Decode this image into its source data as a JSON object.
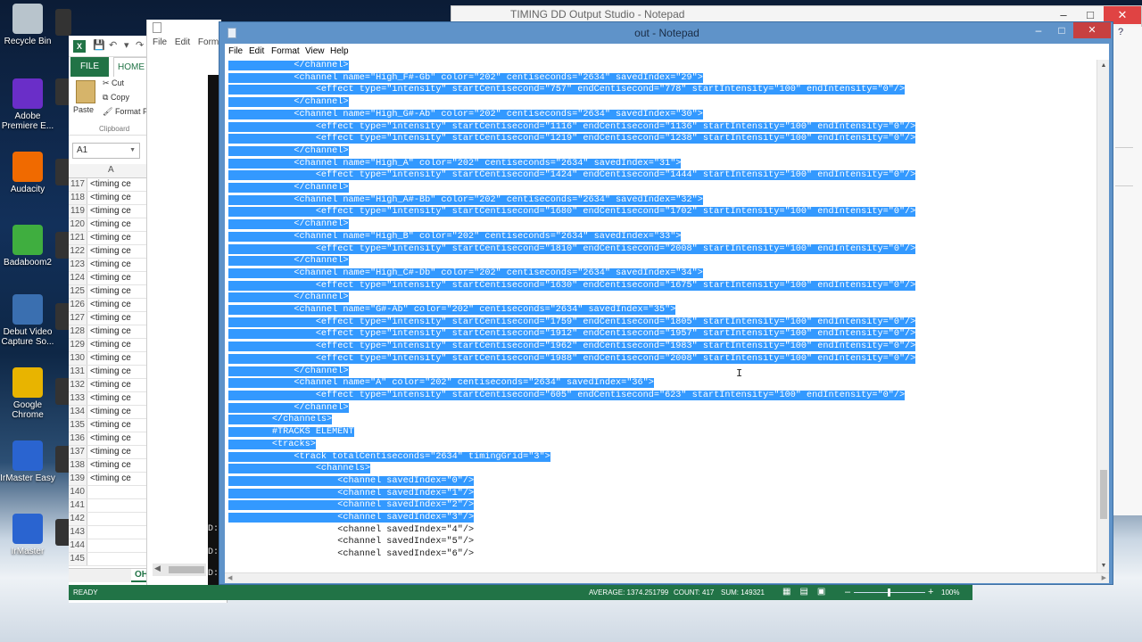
{
  "desktop": {
    "icons": [
      {
        "label": "Recycle Bin",
        "icon": "recycle-bin-icon",
        "color": "#b8c4cc"
      },
      {
        "label": "Adobe Premiere E...",
        "icon": "premiere-icon",
        "color": "#6a2ec8"
      },
      {
        "label": "Audacity",
        "icon": "audacity-icon",
        "color": "#f06a00"
      },
      {
        "label": "Badaboom2",
        "icon": "badaboom-icon",
        "color": "#3fae3f"
      },
      {
        "label": "Debut Video Capture So...",
        "icon": "debut-icon",
        "color": "#3a6fb0"
      },
      {
        "label": "Google Chrome",
        "icon": "chrome-icon",
        "color": "#e8b400"
      },
      {
        "label": "IrMaster Easy",
        "icon": "irmaster-easy-icon",
        "color": "#2a64d0"
      },
      {
        "label": "IrMaster",
        "icon": "irmaster-icon",
        "color": "#2a64d0"
      }
    ]
  },
  "background_window": {
    "title": "TIMING DD Output Studio - Notepad"
  },
  "excel": {
    "file_tab": "FILE",
    "home_tab": "HOME",
    "paste": "Paste",
    "cut": "Cut",
    "copy": "Copy",
    "format_painter": "Format P",
    "clipboard": "Clipboard",
    "name_box": "A1",
    "col_header": "A",
    "rows": [
      {
        "n": "117",
        "v": "<timing ce"
      },
      {
        "n": "118",
        "v": "<timing ce"
      },
      {
        "n": "119",
        "v": "<timing ce"
      },
      {
        "n": "120",
        "v": "<timing ce"
      },
      {
        "n": "121",
        "v": "<timing ce"
      },
      {
        "n": "122",
        "v": "<timing ce"
      },
      {
        "n": "123",
        "v": "<timing ce"
      },
      {
        "n": "124",
        "v": "<timing ce"
      },
      {
        "n": "125",
        "v": "<timing ce"
      },
      {
        "n": "126",
        "v": "<timing ce"
      },
      {
        "n": "127",
        "v": "<timing ce"
      },
      {
        "n": "128",
        "v": "<timing ce"
      },
      {
        "n": "129",
        "v": "<timing ce"
      },
      {
        "n": "130",
        "v": "<timing ce"
      },
      {
        "n": "131",
        "v": "<timing ce"
      },
      {
        "n": "132",
        "v": "<timing ce"
      },
      {
        "n": "133",
        "v": "<timing ce"
      },
      {
        "n": "134",
        "v": "<timing ce"
      },
      {
        "n": "135",
        "v": "<timing ce"
      },
      {
        "n": "136",
        "v": "<timing ce"
      },
      {
        "n": "137",
        "v": "<timing ce"
      },
      {
        "n": "138",
        "v": "<timing ce"
      },
      {
        "n": "139",
        "v": "<timing ce"
      },
      {
        "n": "140",
        "v": ""
      },
      {
        "n": "141",
        "v": ""
      },
      {
        "n": "142",
        "v": ""
      },
      {
        "n": "143",
        "v": ""
      },
      {
        "n": "144",
        "v": ""
      },
      {
        "n": "145",
        "v": ""
      }
    ],
    "sheet_tab": "OH"
  },
  "statusbar": {
    "ready": "READY",
    "average": "AVERAGE: 1374.251799",
    "count": "COUNT: 417",
    "sum": "SUM: 149321",
    "zoom": "100%"
  },
  "mid_window": {
    "menu": [
      "File",
      "Edit",
      "Forma"
    ]
  },
  "notepad": {
    "title": "out - Notepad",
    "menu": [
      "File",
      "Edit",
      "Format",
      "View",
      "Help"
    ],
    "lines": [
      {
        "pre": "",
        "sel": "            </channel>",
        "post": ""
      },
      {
        "pre": "",
        "sel": "            <channel name=\"High_F#-Gb\" color=\"202\" centiseconds=\"2634\" savedIndex=\"29\">",
        "post": ""
      },
      {
        "pre": "",
        "sel": "                <effect type=\"intensity\" startCentisecond=\"757\" endCentisecond=\"778\" startIntensity=\"100\" endIntensity=\"0\"/>",
        "post": ""
      },
      {
        "pre": "",
        "sel": "            </channel>",
        "post": ""
      },
      {
        "pre": "",
        "sel": "            <channel name=\"High_G#-Ab\" color=\"202\" centiseconds=\"2634\" savedIndex=\"30\">",
        "post": ""
      },
      {
        "pre": "",
        "sel": "                <effect type=\"intensity\" startCentisecond=\"1116\" endCentisecond=\"1136\" startIntensity=\"100\" endIntensity=\"0\"/>",
        "post": ""
      },
      {
        "pre": "",
        "sel": "                <effect type=\"intensity\" startCentisecond=\"1219\" endCentisecond=\"1238\" startIntensity=\"100\" endIntensity=\"0\"/>",
        "post": ""
      },
      {
        "pre": "",
        "sel": "            </channel>",
        "post": ""
      },
      {
        "pre": "",
        "sel": "            <channel name=\"High_A\" color=\"202\" centiseconds=\"2634\" savedIndex=\"31\">",
        "post": ""
      },
      {
        "pre": "",
        "sel": "                <effect type=\"intensity\" startCentisecond=\"1424\" endCentisecond=\"1444\" startIntensity=\"100\" endIntensity=\"0\"/>",
        "post": ""
      },
      {
        "pre": "",
        "sel": "            </channel>",
        "post": ""
      },
      {
        "pre": "",
        "sel": "            <channel name=\"High_A#-Bb\" color=\"202\" centiseconds=\"2634\" savedIndex=\"32\">",
        "post": ""
      },
      {
        "pre": "",
        "sel": "                <effect type=\"intensity\" startCentisecond=\"1680\" endCentisecond=\"1702\" startIntensity=\"100\" endIntensity=\"0\"/>",
        "post": ""
      },
      {
        "pre": "",
        "sel": "            </channel>",
        "post": ""
      },
      {
        "pre": "",
        "sel": "            <channel name=\"High_B\" color=\"202\" centiseconds=\"2634\" savedIndex=\"33\">",
        "post": ""
      },
      {
        "pre": "",
        "sel": "                <effect type=\"intensity\" startCentisecond=\"1810\" endCentisecond=\"2008\" startIntensity=\"100\" endIntensity=\"0\"/>",
        "post": ""
      },
      {
        "pre": "",
        "sel": "            </channel>",
        "post": ""
      },
      {
        "pre": "",
        "sel": "            <channel name=\"High_C#-Db\" color=\"202\" centiseconds=\"2634\" savedIndex=\"34\">",
        "post": ""
      },
      {
        "pre": "",
        "sel": "                <effect type=\"intensity\" startCentisecond=\"1630\" endCentisecond=\"1675\" startIntensity=\"100\" endIntensity=\"0\"/>",
        "post": ""
      },
      {
        "pre": "",
        "sel": "            </channel>",
        "post": ""
      },
      {
        "pre": "",
        "sel": "            <channel name=\"G#-Ab\" color=\"202\" centiseconds=\"2634\" savedIndex=\"35\">",
        "post": ""
      },
      {
        "pre": "",
        "sel": "                <effect type=\"intensity\" startCentisecond=\"1759\" endCentisecond=\"1805\" startIntensity=\"100\" endIntensity=\"0\"/>",
        "post": ""
      },
      {
        "pre": "",
        "sel": "                <effect type=\"intensity\" startCentisecond=\"1912\" endCentisecond=\"1957\" startIntensity=\"100\" endIntensity=\"0\"/>",
        "post": ""
      },
      {
        "pre": "",
        "sel": "                <effect type=\"intensity\" startCentisecond=\"1962\" endCentisecond=\"1983\" startIntensity=\"100\" endIntensity=\"0\"/>",
        "post": ""
      },
      {
        "pre": "",
        "sel": "                <effect type=\"intensity\" startCentisecond=\"1988\" endCentisecond=\"2008\" startIntensity=\"100\" endIntensity=\"0\"/>",
        "post": ""
      },
      {
        "pre": "",
        "sel": "            </channel>",
        "post": ""
      },
      {
        "pre": "",
        "sel": "            <channel name=\"A\" color=\"202\" centiseconds=\"2634\" savedIndex=\"36\">",
        "post": ""
      },
      {
        "pre": "",
        "sel": "                <effect type=\"intensity\" startCentisecond=\"605\" endCentisecond=\"623\" startIntensity=\"100\" endIntensity=\"0\"/>",
        "post": ""
      },
      {
        "pre": "",
        "sel": "            </channel>",
        "post": ""
      },
      {
        "pre": "",
        "sel": "        </channels>",
        "post": ""
      },
      {
        "pre": "",
        "sel": "        #TRACKS ELEMENT",
        "post": ""
      },
      {
        "pre": "",
        "sel": "        <tracks>",
        "post": ""
      },
      {
        "pre": "",
        "sel": "            <track totalCentiseconds=\"2634\" timingGrid=\"3\">",
        "post": ""
      },
      {
        "pre": "",
        "sel": "                <channels>",
        "post": ""
      },
      {
        "pre": "",
        "sel": "                    <channel savedIndex=\"0\"/>",
        "post": ""
      },
      {
        "pre": "",
        "sel": "                    <channel savedIndex=\"1\"/>",
        "post": ""
      },
      {
        "pre": "",
        "sel": "                    <channel savedIndex=\"2\"/>",
        "post": ""
      },
      {
        "pre": "",
        "sel": "                    <channel savedIndex=\"3\"/>",
        "post": ""
      },
      {
        "pre": "                    <channel savedIndex=\"4\"/>",
        "sel": "",
        "post": ""
      },
      {
        "pre": "                    <channel savedIndex=\"5\"/>",
        "sel": "",
        "post": ""
      },
      {
        "pre": "                    <channel savedIndex=\"6\"/>",
        "sel": "",
        "post": ""
      }
    ]
  }
}
